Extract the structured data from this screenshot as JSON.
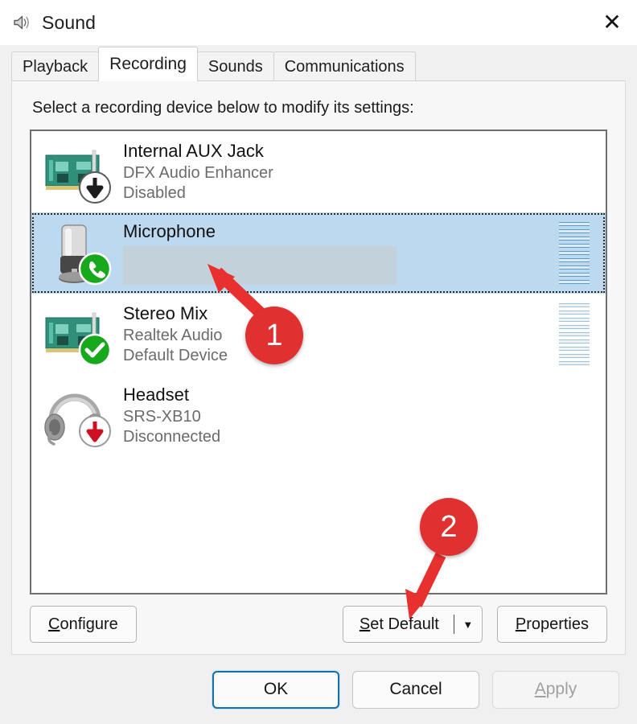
{
  "window": {
    "title": "Sound",
    "icon": "sound-speaker-icon",
    "close_label": "✕"
  },
  "tabs": [
    {
      "label": "Playback",
      "active": false
    },
    {
      "label": "Recording",
      "active": true
    },
    {
      "label": "Sounds",
      "active": false
    },
    {
      "label": "Communications",
      "active": false
    }
  ],
  "page": {
    "prompt": "Select a recording device below to modify its settings:"
  },
  "devices": [
    {
      "name": "Internal AUX Jack",
      "subtitle": "DFX Audio Enhancer",
      "status": "Disabled",
      "icon": "sound-card-icon",
      "badge": "disabled-down-arrow-icon",
      "selected": false,
      "meter": false,
      "redacted": false
    },
    {
      "name": "Microphone",
      "subtitle": "",
      "status": "",
      "icon": "desktop-microphone-icon",
      "badge": "default-communications-phone-icon",
      "selected": true,
      "meter": true,
      "redacted": true
    },
    {
      "name": "Stereo Mix",
      "subtitle": "Realtek Audio",
      "status": "Default Device",
      "icon": "sound-card-icon",
      "badge": "default-device-check-icon",
      "selected": false,
      "meter": true,
      "redacted": false
    },
    {
      "name": "Headset",
      "subtitle": "SRS-XB10",
      "status": "Disconnected",
      "icon": "headset-icon",
      "badge": "disconnected-red-down-arrow-icon",
      "selected": false,
      "meter": false,
      "redacted": false
    }
  ],
  "actions": {
    "configure": {
      "prefix": "C",
      "rest": "onfigure"
    },
    "set_default": {
      "prefix": "S",
      "rest": "et Default"
    },
    "set_default_arrow": "▼",
    "properties": {
      "prefix": "P",
      "rest": "roperties"
    }
  },
  "footer": {
    "ok": "OK",
    "cancel": "Cancel",
    "apply_prefix": "A",
    "apply_rest": "pply"
  },
  "annotations": [
    {
      "number": "1",
      "target": "microphone-row"
    },
    {
      "number": "2",
      "target": "set-default-button"
    }
  ],
  "colors": {
    "selection": "#bcd9f0",
    "annotation": "#e03030",
    "default_button_border": "#1a6fa3",
    "meter": "#9dc3d8"
  }
}
